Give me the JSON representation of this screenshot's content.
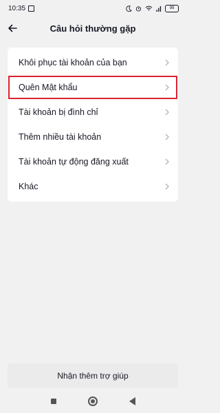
{
  "status_bar": {
    "time": "10:35",
    "battery": "98"
  },
  "header": {
    "title": "Câu hỏi thường gặp"
  },
  "faq": {
    "items": [
      {
        "label": "Khôi phục tài khoản của bạn"
      },
      {
        "label": "Quên Mật khẩu",
        "highlighted": true
      },
      {
        "label": "Tài khoản bị đình chỉ"
      },
      {
        "label": "Thêm nhiều tài khoản"
      },
      {
        "label": "Tài khoản tự động đăng xuất"
      },
      {
        "label": "Khác"
      }
    ]
  },
  "footer": {
    "help_label": "Nhận thêm trợ giúp"
  },
  "colors": {
    "highlight": "#d9232f",
    "background": "#f1f1f2"
  },
  "icons": [
    "back-arrow-icon",
    "chevron-right-icon",
    "moon-icon",
    "alarm-icon",
    "signal-icon",
    "wifi-icon",
    "battery-icon"
  ]
}
